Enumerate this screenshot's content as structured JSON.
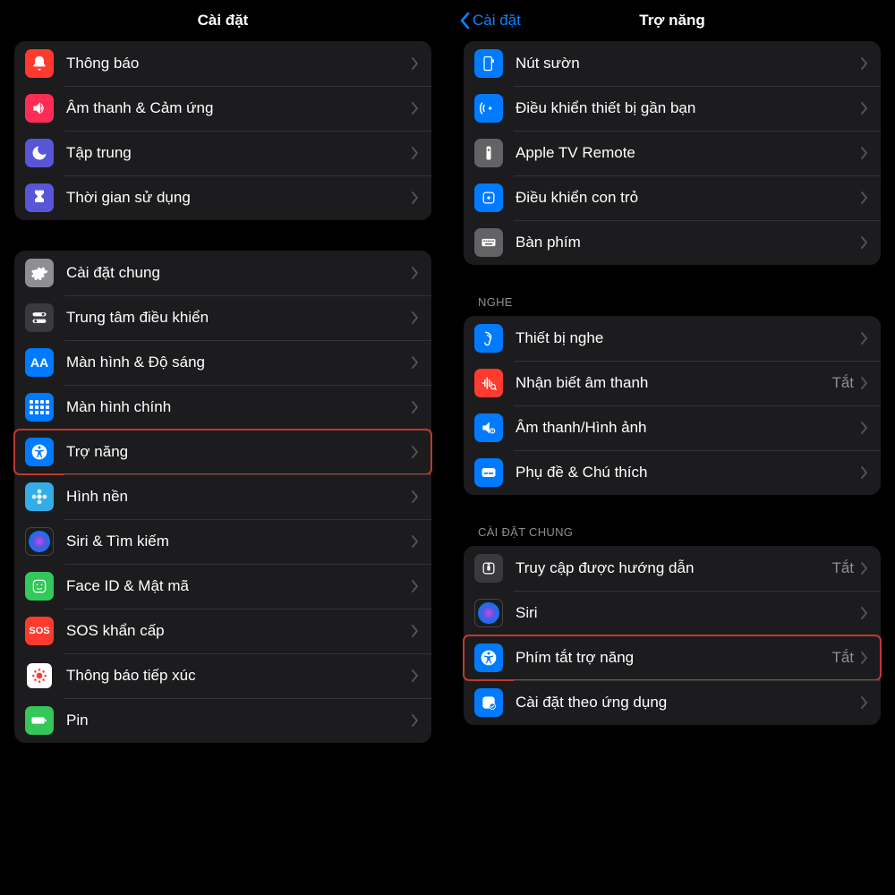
{
  "left": {
    "title": "Cài đặt",
    "group1": [
      {
        "name": "notifications",
        "label": "Thông báo",
        "icon": "bell",
        "bg": "bg-red"
      },
      {
        "name": "sounds",
        "label": "Âm thanh & Cảm ứng",
        "icon": "speaker",
        "bg": "bg-pink"
      },
      {
        "name": "focus",
        "label": "Tập trung",
        "icon": "moon",
        "bg": "bg-purple"
      },
      {
        "name": "screentime",
        "label": "Thời gian sử dụng",
        "icon": "hourglass",
        "bg": "bg-purple"
      }
    ],
    "group2": [
      {
        "name": "general",
        "label": "Cài đặt chung",
        "icon": "gear",
        "bg": "bg-gray"
      },
      {
        "name": "control-center",
        "label": "Trung tâm điều khiển",
        "icon": "switches",
        "bg": "bg-darkgray"
      },
      {
        "name": "display",
        "label": "Màn hình & Độ sáng",
        "icon": "aa",
        "bg": "bg-blue"
      },
      {
        "name": "home-screen",
        "label": "Màn hình chính",
        "icon": "grid",
        "bg": "bg-blue"
      },
      {
        "name": "accessibility",
        "label": "Trợ năng",
        "icon": "accessibility",
        "bg": "bg-blue",
        "highlight": true
      },
      {
        "name": "wallpaper",
        "label": "Hình nền",
        "icon": "flower",
        "bg": "bg-cyan"
      },
      {
        "name": "siri",
        "label": "Siri & Tìm kiếm",
        "icon": "siri",
        "bg": "bg-black"
      },
      {
        "name": "faceid",
        "label": "Face ID & Mật mã",
        "icon": "face",
        "bg": "bg-green"
      },
      {
        "name": "sos",
        "label": "SOS khẩn cấp",
        "icon": "sos",
        "bg": "bg-red"
      },
      {
        "name": "exposure",
        "label": "Thông báo tiếp xúc",
        "icon": "exposure",
        "bg": ""
      },
      {
        "name": "battery",
        "label": "Pin",
        "icon": "battery",
        "bg": "bg-green"
      }
    ]
  },
  "right": {
    "title": "Trợ năng",
    "back": "Cài đặt",
    "group1": [
      {
        "name": "side-button",
        "label": "Nút sườn",
        "icon": "sidebutton",
        "bg": "bg-blue"
      },
      {
        "name": "nearby-control",
        "label": "Điều khiển thiết bị gần bạn",
        "icon": "nearby",
        "bg": "bg-blue"
      },
      {
        "name": "apple-tv-remote",
        "label": "Apple TV Remote",
        "icon": "remote",
        "bg": "bg-lightgray"
      },
      {
        "name": "pointer-control",
        "label": "Điều khiển con trỏ",
        "icon": "pointer",
        "bg": "bg-blue"
      },
      {
        "name": "keyboards",
        "label": "Bàn phím",
        "icon": "keyboard",
        "bg": "bg-lightgray"
      }
    ],
    "section2_header": "NGHE",
    "group2": [
      {
        "name": "hearing-devices",
        "label": "Thiết bị nghe",
        "icon": "ear",
        "bg": "bg-blue"
      },
      {
        "name": "sound-recognition",
        "label": "Nhận biết âm thanh",
        "icon": "soundrec",
        "bg": "bg-red",
        "value": "Tắt"
      },
      {
        "name": "audio-visual",
        "label": "Âm thanh/Hình ảnh",
        "icon": "audiovisual",
        "bg": "bg-blue"
      },
      {
        "name": "subtitles",
        "label": "Phụ đề & Chú thích",
        "icon": "subtitles",
        "bg": "bg-blue"
      }
    ],
    "section3_header": "CÀI ĐẶT CHUNG",
    "group3": [
      {
        "name": "guided-access",
        "label": "Truy cập được hướng dẫn",
        "icon": "guided",
        "bg": "bg-darkgray",
        "value": "Tắt"
      },
      {
        "name": "siri",
        "label": "Siri",
        "icon": "siri",
        "bg": "bg-black"
      },
      {
        "name": "accessibility-shortcut",
        "label": "Phím tắt trợ năng",
        "icon": "accessibility",
        "bg": "bg-blue",
        "value": "Tắt",
        "highlight": true
      },
      {
        "name": "per-app",
        "label": "Cài đặt theo ứng dụng",
        "icon": "perapp",
        "bg": "bg-blue"
      }
    ]
  }
}
